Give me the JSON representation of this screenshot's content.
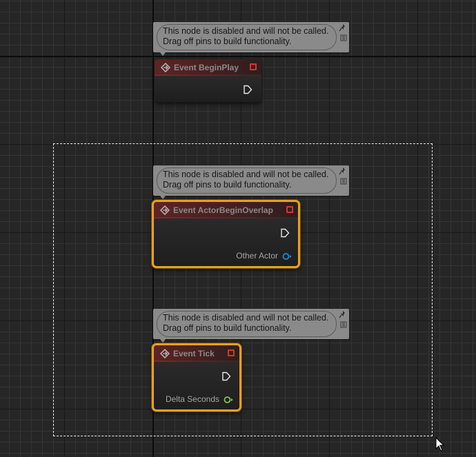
{
  "comments": [
    {
      "line1": "This node is disabled and will not be called.",
      "line2": "Drag off pins to build functionality."
    },
    {
      "line1": "This node is disabled and will not be called.",
      "line2": "Drag off pins to build functionality."
    },
    {
      "line1": "This node is disabled and will not be called.",
      "line2": "Drag off pins to build functionality."
    }
  ],
  "nodes": {
    "begin_play": {
      "title": "Event BeginPlay"
    },
    "actor_begin_overlap": {
      "title": "Event ActorBeginOverlap",
      "output_pin": "Other Actor"
    },
    "tick": {
      "title": "Event Tick",
      "output_pin": "Delta Seconds"
    }
  },
  "colors": {
    "selection_outline": "#e8a020",
    "event_header": "#5e2424",
    "delegate_pin": "#e03030",
    "object_pin": "#1e88d8",
    "float_pin": "#8bc34a"
  },
  "icons": [
    "event-icon",
    "delegate-icon",
    "exec-pin-icon",
    "object-pin-icon",
    "float-pin-icon",
    "pin-icon",
    "expand-icon",
    "mouse-cursor-icon"
  ]
}
